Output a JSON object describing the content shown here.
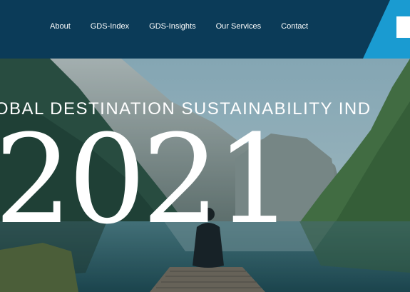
{
  "nav": {
    "items": [
      {
        "label": "About"
      },
      {
        "label": "GDS-Index"
      },
      {
        "label": "GDS-Insights"
      },
      {
        "label": "Our Services"
      },
      {
        "label": "Contact"
      }
    ]
  },
  "hero": {
    "title": "LOBAL DESTINATION SUSTAINABILITY IND",
    "year": "2021"
  },
  "colors": {
    "header_bg": "#0b3b58",
    "accent": "#1a9bd1",
    "text": "#ffffff"
  }
}
